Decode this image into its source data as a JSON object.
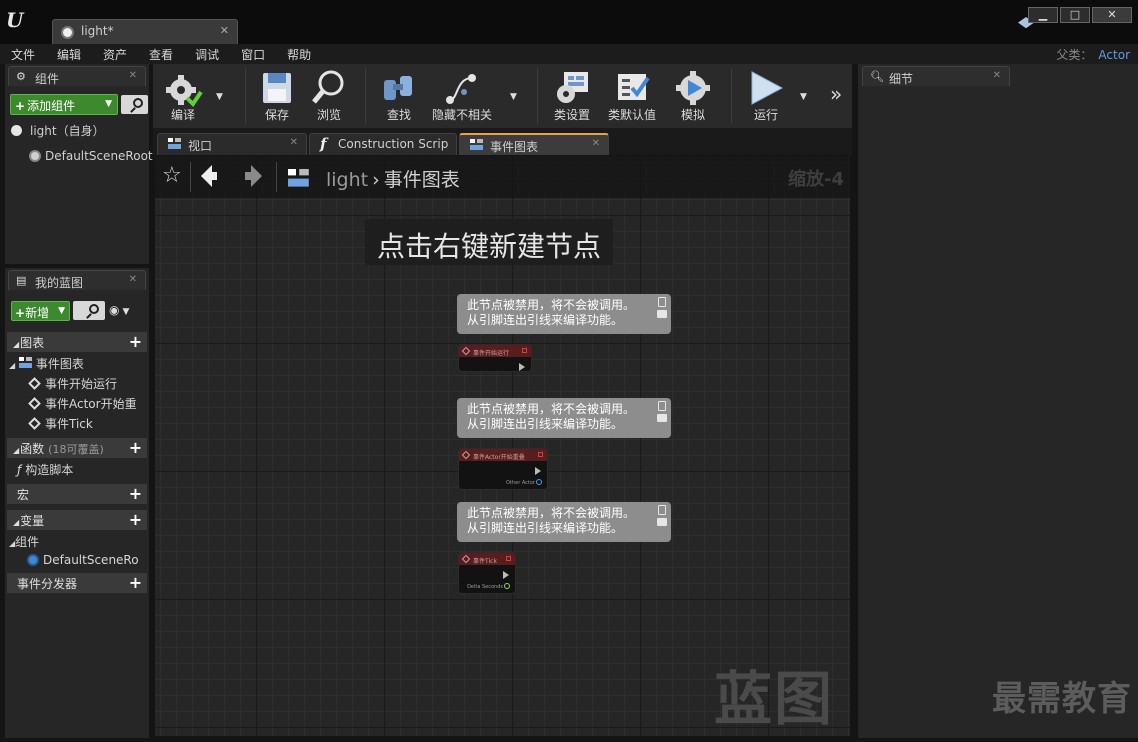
{
  "window": {
    "tab_title": "light*",
    "close_glyph": "✕",
    "min_glyph": "▁",
    "max_glyph": "□"
  },
  "menu": [
    "文件",
    "编辑",
    "资产",
    "查看",
    "调试",
    "窗口",
    "帮助"
  ],
  "parent_class": {
    "label": "父类：",
    "value": "Actor"
  },
  "components_panel": {
    "title": "组件",
    "add_button": "添加组件",
    "tree": [
      "light（自身）",
      "DefaultSceneRoot"
    ]
  },
  "my_blueprint": {
    "title": "我的蓝图",
    "new_button": "新增",
    "sections": {
      "graphs": "图表",
      "event_graph": "事件图表",
      "events": [
        "事件开始运行",
        "事件Actor开始重",
        "事件Tick"
      ],
      "functions": "函数",
      "functions_override": "(18可覆盖)",
      "construction": "构造脚本",
      "macros": "宏",
      "variables": "变量",
      "components": "组件",
      "components_item": "DefaultSceneRo",
      "dispatchers": "事件分发器"
    }
  },
  "toolbar": {
    "compile": "编译",
    "save": "保存",
    "browse": "浏览",
    "find": "查找",
    "hide_unrelated": "隐藏不相关",
    "class_settings": "类设置",
    "class_defaults": "类默认值",
    "simulate": "模拟",
    "play": "运行"
  },
  "editor_tabs": [
    "视口",
    "Construction Scrip",
    "事件图表"
  ],
  "graph": {
    "breadcrumb_root": "light",
    "breadcrumb_current": "事件图表",
    "zoom": "缩放-4",
    "hint": "点击右键新建节点",
    "watermark": "蓝图",
    "comment_line1": "此节点被禁用，将不会被调用。",
    "comment_line2": "从引脚连出引线来编译功能。",
    "nodes": [
      {
        "title": "事件开始运行"
      },
      {
        "title": "事件Actor开始重叠",
        "pin": "Other Actor"
      },
      {
        "title": "事件Tick",
        "pin": "Delta Seconds"
      }
    ]
  },
  "details_panel": {
    "title": "细节"
  },
  "brand_watermark": "最需教育",
  "colors": {
    "accent_green": "#3d8a2e",
    "link_blue": "#5d9be0",
    "tab_active": "#e8a33d",
    "event_red": "#5a1d1d"
  }
}
